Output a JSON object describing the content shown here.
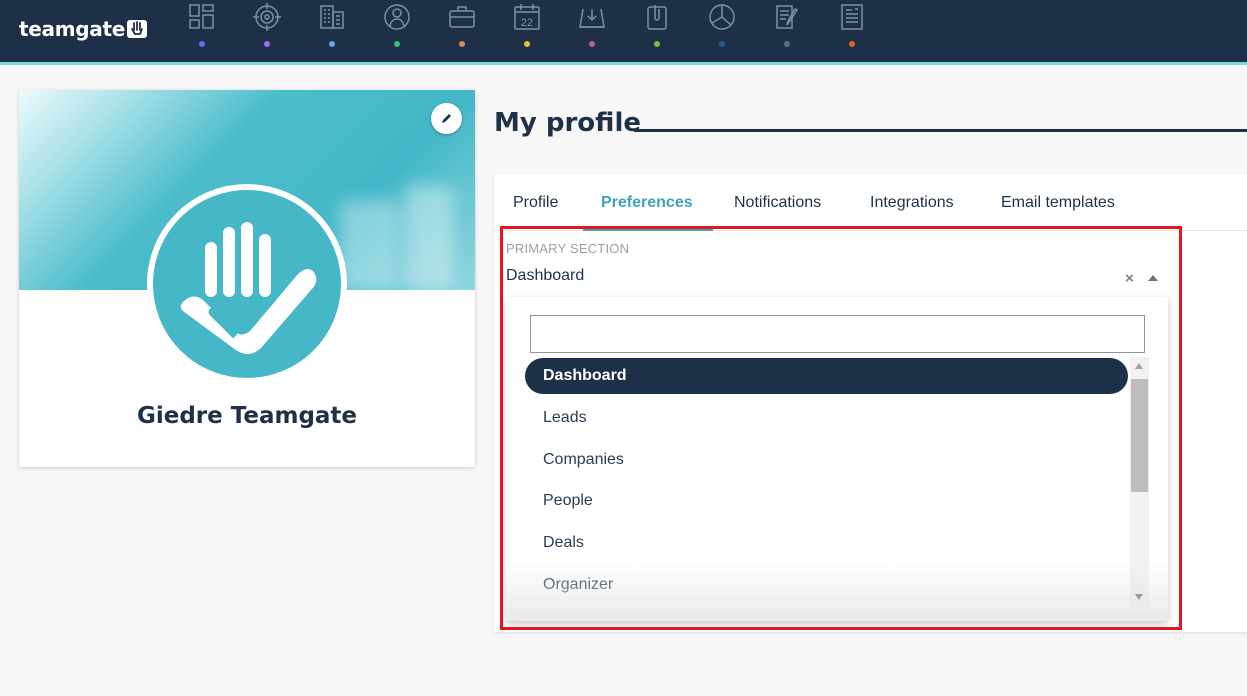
{
  "app": {
    "logo_text": "teamgate"
  },
  "nav": [
    {
      "icon": "dashboard-icon",
      "dot_color": "#6a6cf0"
    },
    {
      "icon": "target-icon",
      "dot_color": "#a66df0"
    },
    {
      "icon": "building-icon",
      "dot_color": "#5aa8e6"
    },
    {
      "icon": "person-icon",
      "dot_color": "#36c46a"
    },
    {
      "icon": "briefcase-icon",
      "dot_color": "#e38b4a"
    },
    {
      "icon": "calendar-icon",
      "dot_color": "#e6c23a",
      "label": "22"
    },
    {
      "icon": "inbox-icon",
      "dot_color": "#c35aa8"
    },
    {
      "icon": "paperclip-icon",
      "dot_color": "#7ac33a"
    },
    {
      "icon": "pie-chart-icon",
      "dot_color": "#2b5a8a"
    },
    {
      "icon": "notes-icon",
      "dot_color": "#5e6b78"
    },
    {
      "icon": "invoice-icon",
      "dot_color": "#e0651f"
    }
  ],
  "profile": {
    "name": "Giedre Teamgate"
  },
  "page": {
    "title": "My profile"
  },
  "tabs": [
    "Profile",
    "Preferences",
    "Notifications",
    "Integrations",
    "Email templates"
  ],
  "active_tab": "Preferences",
  "primary_section": {
    "label": "PRIMARY SECTION",
    "value": "Dashboard",
    "clear_symbol": "×",
    "search_value": "",
    "options": [
      "Dashboard",
      "Leads",
      "Companies",
      "People",
      "Deals",
      "Organizer"
    ],
    "selected": "Dashboard"
  },
  "colors": {
    "navbar": "#1d3048",
    "accent": "#3fa2bb",
    "highlight": "#e8131d"
  }
}
